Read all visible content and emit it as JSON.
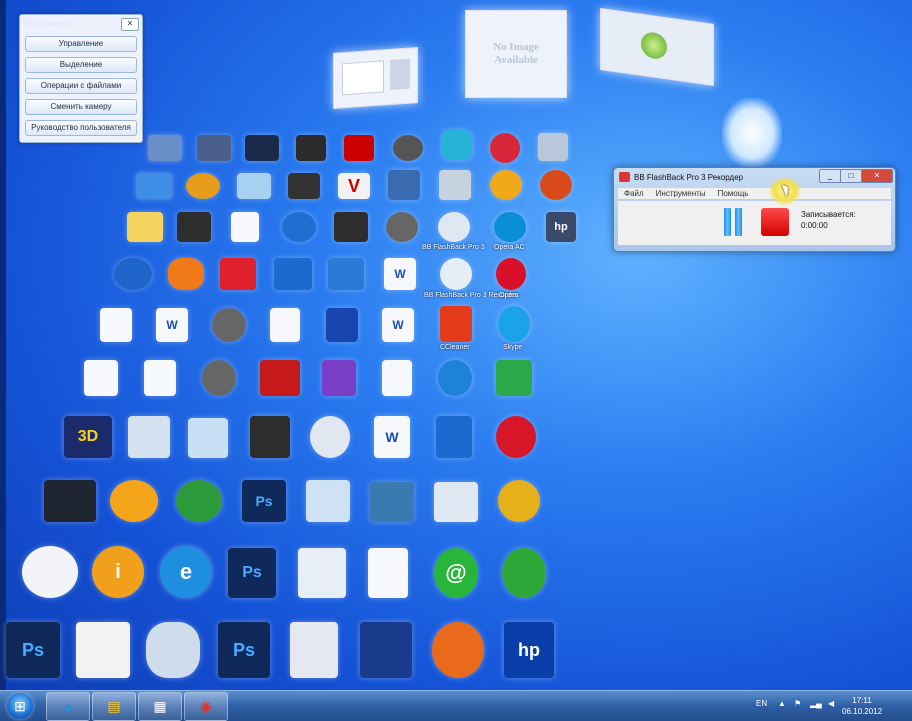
{
  "menu": {
    "title": "3D положения",
    "close": "✕",
    "buttons": [
      "Управление",
      "Выделение",
      "Операции с файлами",
      "Сменить камеру",
      "Руководство пользователя"
    ]
  },
  "previews": {
    "no_image": "No Image Available"
  },
  "recorder": {
    "title": "BB FlashBack Pro 3 Рекордер",
    "menu": [
      "Файл",
      "Инструменты",
      "Помощь"
    ],
    "status_label": "Записывается:",
    "status_time": "0:00:00",
    "controls": [
      "_",
      "□",
      "✕"
    ]
  },
  "icons": {
    "labels": {
      "bb_flashback_1": "BB FlashBack Pro 3",
      "opera_ac": "Opera AC",
      "bb_flashback_rec": "BB FlashBack Pro 3 Recorder",
      "opera": "Opera",
      "ccleaner": "CCleaner",
      "skype": "Skype"
    },
    "text": {
      "ps": "Ps",
      "hp": "hp",
      "word": "W",
      "at": "@"
    }
  },
  "taskbar": {
    "language": "EN",
    "time": "17:11",
    "date": "06.10.2012"
  }
}
